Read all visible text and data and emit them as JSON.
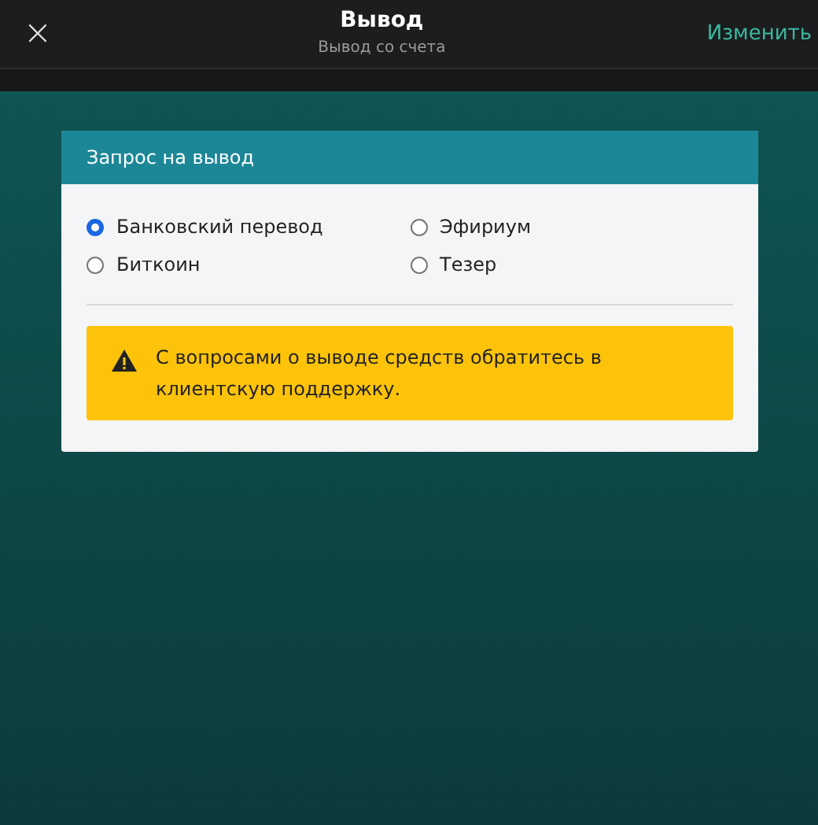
{
  "header": {
    "close": "×",
    "title": "Вывод",
    "subtitle": "Вывод со счета",
    "action": "Изменить"
  },
  "card": {
    "title": "Запрос на вывод",
    "options": [
      {
        "label": "Банковский перевод",
        "selected": true
      },
      {
        "label": "Эфириум",
        "selected": false
      },
      {
        "label": "Биткоин",
        "selected": false
      },
      {
        "label": "Тезер",
        "selected": false
      }
    ],
    "alert": "С вопросами о выводе средств обратитесь в клиентскую поддержку."
  }
}
